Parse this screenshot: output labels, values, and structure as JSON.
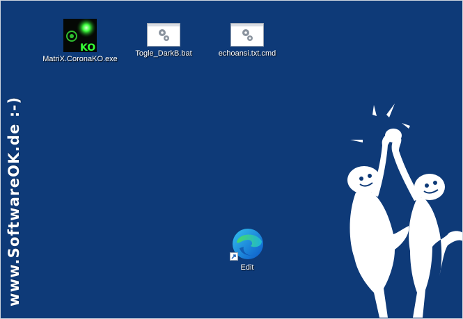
{
  "desktop": {
    "background_color": "#0e3a78",
    "watermark": "www.SoftwareOK.de :-)",
    "icons": [
      {
        "label": "MatriX.CoronaKO.exe",
        "icon": "matrix-app-icon",
        "badge": "KO"
      },
      {
        "label": "Togle_DarkB.bat",
        "icon": "batch-file-icon"
      },
      {
        "label": "echoansi.txt.cmd",
        "icon": "batch-file-icon"
      },
      {
        "label": "Edit",
        "icon": "edge-browser-icon",
        "shortcut": true
      }
    ]
  }
}
